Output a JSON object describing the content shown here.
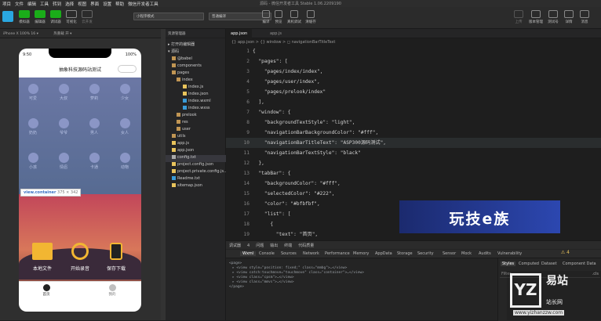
{
  "menu": [
    "项目",
    "文件",
    "编辑",
    "工具",
    "转到",
    "选择",
    "视图",
    "界面",
    "设置",
    "帮助",
    "微信开发者工具"
  ],
  "window_title": "源码 - 微信开发者工具 Stable 1.06.2209190",
  "toolbar": {
    "left_buttons": [
      "模拟器",
      "编辑器",
      "调试器",
      "可视化",
      "云开发"
    ],
    "mode_select": "小程序模式",
    "compile_select": "普通编译",
    "center_buttons": [
      "编译",
      "预览",
      "真机调试",
      "清缓存"
    ],
    "right_buttons": [
      "上传",
      "版本管理",
      "测试号",
      "详情",
      "消息"
    ]
  },
  "simulator": {
    "device": "iPhone X 100% 16 ▾",
    "hotreload": "热重载 开 ▾",
    "status_time": "9:50",
    "status_battery": "100%",
    "nav_title": "抽象科技源码站测试",
    "grid": [
      "可爱",
      "大叔",
      "萝莉",
      "少女",
      "奶奶",
      "爷爷",
      "男人",
      "女人",
      "小孩",
      "情侣",
      "卡通",
      "动物"
    ],
    "tooltip_tag": "view.container",
    "tooltip_dim": "375 × 342",
    "actions": [
      "本地文件",
      "开始录音",
      "保存下载"
    ],
    "tabs": [
      "首页",
      "我的"
    ]
  },
  "explorer": {
    "header": "资源管理器",
    "open_editors": "▸ 打开的编辑器",
    "root": "▾ 源码",
    "items": [
      {
        "label": "@babel",
        "color": "#c09553"
      },
      {
        "label": "components",
        "color": "#c09553"
      },
      {
        "label": "pages",
        "color": "#c09553"
      },
      {
        "label": "index",
        "color": "#c09553"
      },
      {
        "label": "index.js",
        "color": "#e8c35b"
      },
      {
        "label": "index.json",
        "color": "#e8c35b"
      },
      {
        "label": "index.wxml",
        "color": "#3a9bd8"
      },
      {
        "label": "index.wxss",
        "color": "#3a9bd8"
      },
      {
        "label": "prelook",
        "color": "#c09553"
      },
      {
        "label": "res",
        "color": "#c09553"
      },
      {
        "label": "user",
        "color": "#c09553"
      },
      {
        "label": "utils",
        "color": "#c09553"
      },
      {
        "label": "app.js",
        "color": "#e8c35b"
      },
      {
        "label": "app.json",
        "color": "#e8c35b"
      },
      {
        "label": "config.txt",
        "color": "#aaaaaa"
      },
      {
        "label": "project.config.json",
        "color": "#e8c35b"
      },
      {
        "label": "project.private.config.js...",
        "color": "#e8c35b"
      },
      {
        "label": "Readme.txt",
        "color": "#3a9bd8"
      },
      {
        "label": "sitemap.json",
        "color": "#e8c35b"
      }
    ]
  },
  "editor": {
    "tabs": [
      "app.json",
      "app.js"
    ],
    "breadcrumb": "{} app.json > {} window > ◻ navigationBarTitleText",
    "lines": [
      {
        "n": "1",
        "code": "{"
      },
      {
        "n": "2",
        "code": "  \"pages\": ["
      },
      {
        "n": "3",
        "code": "    \"pages/index/index\","
      },
      {
        "n": "4",
        "code": "    \"pages/user/index\","
      },
      {
        "n": "5",
        "code": "    \"pages/prelook/index\""
      },
      {
        "n": "6",
        "code": "  ],"
      },
      {
        "n": "7",
        "code": "  \"window\": {"
      },
      {
        "n": "8",
        "code": "    \"backgroundTextStyle\": \"light\","
      },
      {
        "n": "9",
        "code": "    \"navigationBarBackgroundColor\": \"#fff\","
      },
      {
        "n": "10",
        "code": "    \"navigationBarTitleText\": \"ASP300源码测试\","
      },
      {
        "n": "11",
        "code": "    \"navigationBarTextStyle\": \"black\""
      },
      {
        "n": "12",
        "code": "  },"
      },
      {
        "n": "13",
        "code": "  \"tabBar\": {"
      },
      {
        "n": "14",
        "code": "    \"backgroundColor\": \"#fff\","
      },
      {
        "n": "15",
        "code": "    \"selectedColor\": \"#222\","
      },
      {
        "n": "16",
        "code": "    \"color\": \"#bfbfbf\","
      },
      {
        "n": "17",
        "code": "    \"list\": ["
      },
      {
        "n": "18",
        "code": "      {"
      },
      {
        "n": "19",
        "code": "        \"text\": \"首页\","
      }
    ],
    "banner_text": "玩技e族"
  },
  "devtools": {
    "top_tabs": [
      "调试器",
      "4",
      "问题",
      "输出",
      "终端",
      "代码质量"
    ],
    "tabs": [
      "Wxml",
      "Console",
      "Sources",
      "Network",
      "Performance",
      "Memory",
      "AppData",
      "Storage",
      "Security",
      "Sensor",
      "Mock",
      "Audits",
      "Vulnerability"
    ],
    "warn_count": "⚠ 4",
    "dom": [
      "<page>",
      "▸ <view style=\"position: fixed;\" class=\"mmbg\">…</view>",
      "▸ <view catch:touchmove=\"touchmove\" class=\"container\">…</view>",
      "▸ <view class=\"cpsm\">…</view>",
      "▸ <view class=\"mmvs\">…</view>",
      "</page>"
    ],
    "styles_tabs": [
      "Styles",
      "Computed",
      "Dataset",
      "Component Data"
    ],
    "filter": "Filter",
    "cls": ".cls"
  },
  "watermark": {
    "logo": "YZ",
    "cn": "易站",
    "sub": "站长网",
    "url": "www.yizhanzzw.com"
  }
}
